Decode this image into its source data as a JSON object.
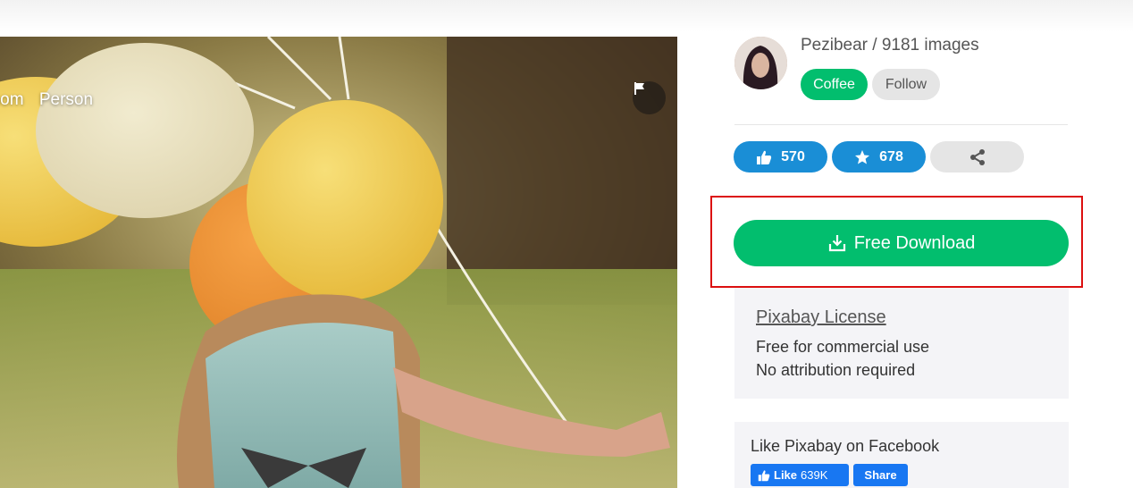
{
  "photo": {
    "tags": [
      "Zoom",
      "Person"
    ],
    "flag_icon": "flag-icon"
  },
  "author": {
    "name_line": "Pezibear / 9181 images",
    "coffee_label": "Coffee",
    "follow_label": "Follow"
  },
  "stats": {
    "likes": "570",
    "favorites": "678",
    "like_icon": "thumbs-up-icon",
    "favorite_icon": "star-icon",
    "share_icon": "share-icon"
  },
  "download": {
    "label": "Free Download",
    "icon": "download-icon"
  },
  "license": {
    "title": "Pixabay License",
    "line1": "Free for commercial use",
    "line2": "No attribution required"
  },
  "facebook": {
    "title": "Like Pixabay on Facebook",
    "like_label": "Like",
    "like_count": "639K",
    "share_label": "Share"
  },
  "colors": {
    "green": "#02be6e",
    "blue": "#1a8ed6",
    "highlight_red": "#dc1010",
    "facebook_blue": "#1877f2"
  }
}
